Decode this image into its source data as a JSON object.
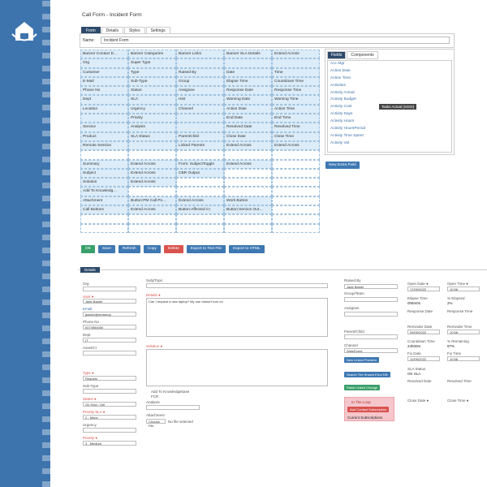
{
  "page_title": "Call Form - Incident Form",
  "tabs": [
    "Form",
    "Details",
    "Styles",
    "Settings"
  ],
  "name_label": "Name:",
  "name_value": "Incident Form",
  "grid": [
    [
      "Banner Contact D…",
      "Banner Categories",
      "Banner Links",
      "Banner SLA Details",
      "Extend Across"
    ],
    [
      "Org",
      "Super Type",
      "",
      "",
      ""
    ],
    [
      "Customer",
      "Type",
      "Raised By",
      "Date",
      "Time"
    ],
    [
      "E-Mail",
      "Sub-Type",
      "Group",
      "Elapse Time",
      "Countdown Time"
    ],
    [
      "Phone No",
      "Status",
      "Assignee",
      "Response Date",
      "Response Time"
    ],
    [
      "Dept",
      "SLA",
      "Hist",
      "Warning Date",
      "Warning Time"
    ],
    [
      "Location",
      "Urgency",
      "Channel",
      "Action Date",
      "Action Time"
    ],
    [
      "",
      "Priority",
      "",
      "End Date",
      "End Time"
    ],
    [
      "Service",
      "Analysis",
      "",
      "Resolved Date",
      "Resolved Time"
    ],
    [
      "Product",
      "SLA Status",
      "ParentChild",
      "Close Date",
      "Close Time"
    ],
    [
      "Remote Session",
      "",
      "Linked Parents",
      "Extend Across",
      "Extend Across"
    ],
    [
      "",
      "",
      "",
      "",
      ""
    ],
    [
      "Summary",
      "Extend Across",
      "Form: SubjectToggle",
      "Extend Across",
      ""
    ],
    [
      "Subject",
      "Extend Across",
      "CBR Output",
      "",
      ""
    ],
    [
      "Solution",
      "Extend Across",
      "",
      "",
      ""
    ],
    [
      "Add To Knowledg…",
      "",
      "",
      "",
      ""
    ],
    [
      "Attachment",
      "Button:PM Call Po…",
      "Extend Across",
      "Work Button",
      ""
    ],
    [
      "Call Buttons",
      "Extend Across",
      "Button:Affected CI",
      "Button:Service Out…",
      ""
    ],
    [
      "",
      "",
      "",
      "",
      ""
    ],
    [
      "",
      "",
      "",
      "",
      ""
    ]
  ],
  "field_tabs": [
    "Fields",
    "Components"
  ],
  "fields": [
    "Acc Mgr",
    "Action Date",
    "Action Time",
    "Activities",
    "Activity Actual",
    "Activity Budget",
    "Activity Cost",
    "Activity Days",
    "Activity Hours",
    "Activity HoursPeriod",
    "Activity Time Spent",
    "Activity Val"
  ],
  "tooltip": "Tasks Actual (SGID)",
  "new_field_button": "New Extra Field",
  "buttons": [
    "OK",
    "Save",
    "Refresh",
    "Copy",
    "Delete",
    "Export to Text File",
    "Export to HTML"
  ],
  "preview": {
    "tab": "Details",
    "org_label": "Org",
    "user_label": "User ●",
    "user_value": "Jade Baxter",
    "email_label": "Email",
    "email_value": "jbaxter@emberop",
    "phone_label": "Phone No",
    "phone_value": "0074984000",
    "dept_label": "Dept",
    "dept_value": "IT",
    "asset_label": "Asset/CI",
    "type_label": "Type ●",
    "type_value": "Request",
    "subtype_label": "Sub-Type",
    "status_label": "Status ●",
    "status_value": "On Hold - Del",
    "sla_label": "Priority SLA ●",
    "sla_value": "2 - Minor",
    "urgency_label": "Urgency",
    "priority_label": "Priority ●",
    "priority_value": "3 - Medium",
    "subj_label": "Subj/Topic",
    "details_label": "Details ●",
    "details_value": "Can I request a new laptop? My one doesn't turn on",
    "solution_label": "Solution ●",
    "kb_label": "Add To Knowledgebase",
    "fcr_label": "FCR",
    "analysis_label": "Analysis",
    "attachment_label": "Attachment",
    "choose_label": "Choose File",
    "nofile": "No file selected",
    "raised_label": "Raised By",
    "raised_value": "Jade Baxter",
    "group_label": "Group/Team",
    "assignee_label": "Assignee",
    "parent_label": "Parent/Child",
    "channel_label": "Channel",
    "channel_value": "Web/Event",
    "new_linked": "New Linked Problem",
    "search_kb": "Search The Known Error DB",
    "raise_change": "Raise Linked Change",
    "loop_label": "In The Loop",
    "add_contact": "Add Contact Subscription",
    "current_subs": "Current Subscriptions",
    "open_date_label": "Open Date ●",
    "open_date": "17/09/2022",
    "open_time_label": "Open Time ●",
    "open_time": "10:58",
    "elapse_label": "Elapse Time",
    "elapse": "0h8m0s",
    "pct_label": "% Elapsed",
    "pct": "2%",
    "resp_date_label": "Response Date",
    "resp_time_label": "Response Time",
    "rem_date_label": "Reminder Date",
    "rem_date": "09/09/2022",
    "rem_time_label": "Reminder Time",
    "rem_time": "10:58",
    "countdown_label": "Countdown Time",
    "countdown": "24h00m",
    "pct_rem_label": "% Remaining",
    "pct_rem": "97%",
    "fix_date_label": "Fix Date",
    "fix_date": "12/09/2022",
    "fix_time_label": "Fix Time",
    "fix_time": "10:58",
    "sla_status_label": "SLA Status",
    "sla_status": "OK SLA",
    "resolved_date_label": "Resolved Date",
    "resolved_time_label": "Resolved Time",
    "close_date_label": "Close Date ●",
    "close_time_label": "Close Time ●"
  }
}
